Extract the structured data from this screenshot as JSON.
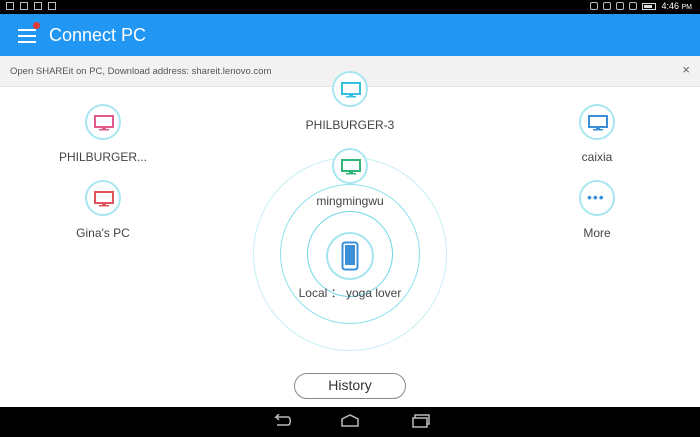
{
  "status_bar": {
    "time": "4:46",
    "ampm": "PM"
  },
  "app_bar": {
    "title": "Connect PC"
  },
  "notice": {
    "text": "Open SHAREit on PC, Download address: shareit.lenovo.com",
    "close": "×"
  },
  "devices": [
    {
      "name": "PHILBURGER-3",
      "color": "#35c0dd"
    },
    {
      "name": "PHILBURGER...",
      "color": "#e05b8c"
    },
    {
      "name": "caixia",
      "color": "#3b8fd9"
    },
    {
      "name": "mingmingwu",
      "color": "#2fb57a"
    },
    {
      "name": "Gina's PC",
      "color": "#e0555b"
    },
    {
      "name": "More",
      "color": "#3b8fd9"
    }
  ],
  "local": {
    "label": "Local ： yoga lover",
    "color": "#3b8fd9"
  },
  "history_button": {
    "label": "History"
  },
  "icons": {
    "menu": "menu-icon",
    "device": "monitor-icon",
    "phone": "phone-icon",
    "more": "more-dots-icon",
    "back": "back-icon",
    "home": "home-icon",
    "recents": "recents-icon"
  }
}
